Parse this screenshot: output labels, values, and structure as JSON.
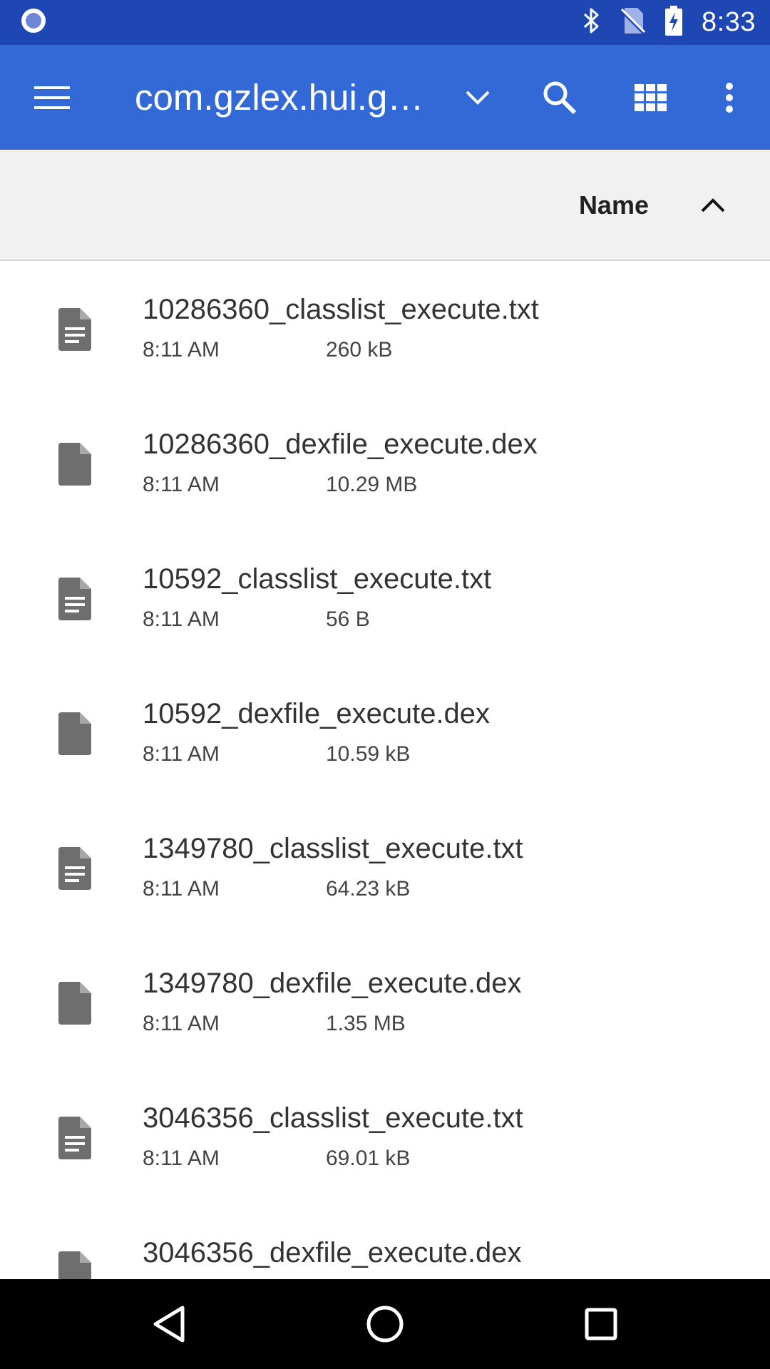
{
  "status_bar": {
    "time": "8:33",
    "icons": [
      "app-notification-icon",
      "bluetooth-icon",
      "no-sim-icon",
      "battery-charging-icon"
    ]
  },
  "app_bar": {
    "menu_icon": "hamburger-menu-icon",
    "title": "com.gzlex.hui.g…",
    "dropdown_icon": "chevron-down-icon",
    "search_icon": "search-icon",
    "view_icon": "grid-view-icon",
    "overflow_icon": "more-vert-icon"
  },
  "sort_header": {
    "label": "Name",
    "direction_icon": "chevron-up-icon"
  },
  "files": [
    {
      "name": "10286360_classlist_execute.txt",
      "time": "8:11 AM",
      "size": "260 kB",
      "icon": "text-file-icon"
    },
    {
      "name": "10286360_dexfile_execute.dex",
      "time": "8:11 AM",
      "size": "10.29 MB",
      "icon": "file-icon"
    },
    {
      "name": "10592_classlist_execute.txt",
      "time": "8:11 AM",
      "size": "56 B",
      "icon": "text-file-icon"
    },
    {
      "name": "10592_dexfile_execute.dex",
      "time": "8:11 AM",
      "size": "10.59 kB",
      "icon": "file-icon"
    },
    {
      "name": "1349780_classlist_execute.txt",
      "time": "8:11 AM",
      "size": "64.23 kB",
      "icon": "text-file-icon"
    },
    {
      "name": "1349780_dexfile_execute.dex",
      "time": "8:11 AM",
      "size": "1.35 MB",
      "icon": "file-icon"
    },
    {
      "name": "3046356_classlist_execute.txt",
      "time": "8:11 AM",
      "size": "69.01 kB",
      "icon": "text-file-icon"
    },
    {
      "name": "3046356_dexfile_execute.dex",
      "time": "",
      "size": "",
      "icon": "file-icon"
    }
  ],
  "nav_bar": {
    "back_icon": "back-icon",
    "home_icon": "home-icon",
    "recents_icon": "recents-icon"
  },
  "colors": {
    "status_bar": "#1f47b4",
    "app_bar": "#3269d6",
    "sort_header_bg": "#f1f1f1",
    "icon_gray": "#6e6e6e"
  }
}
